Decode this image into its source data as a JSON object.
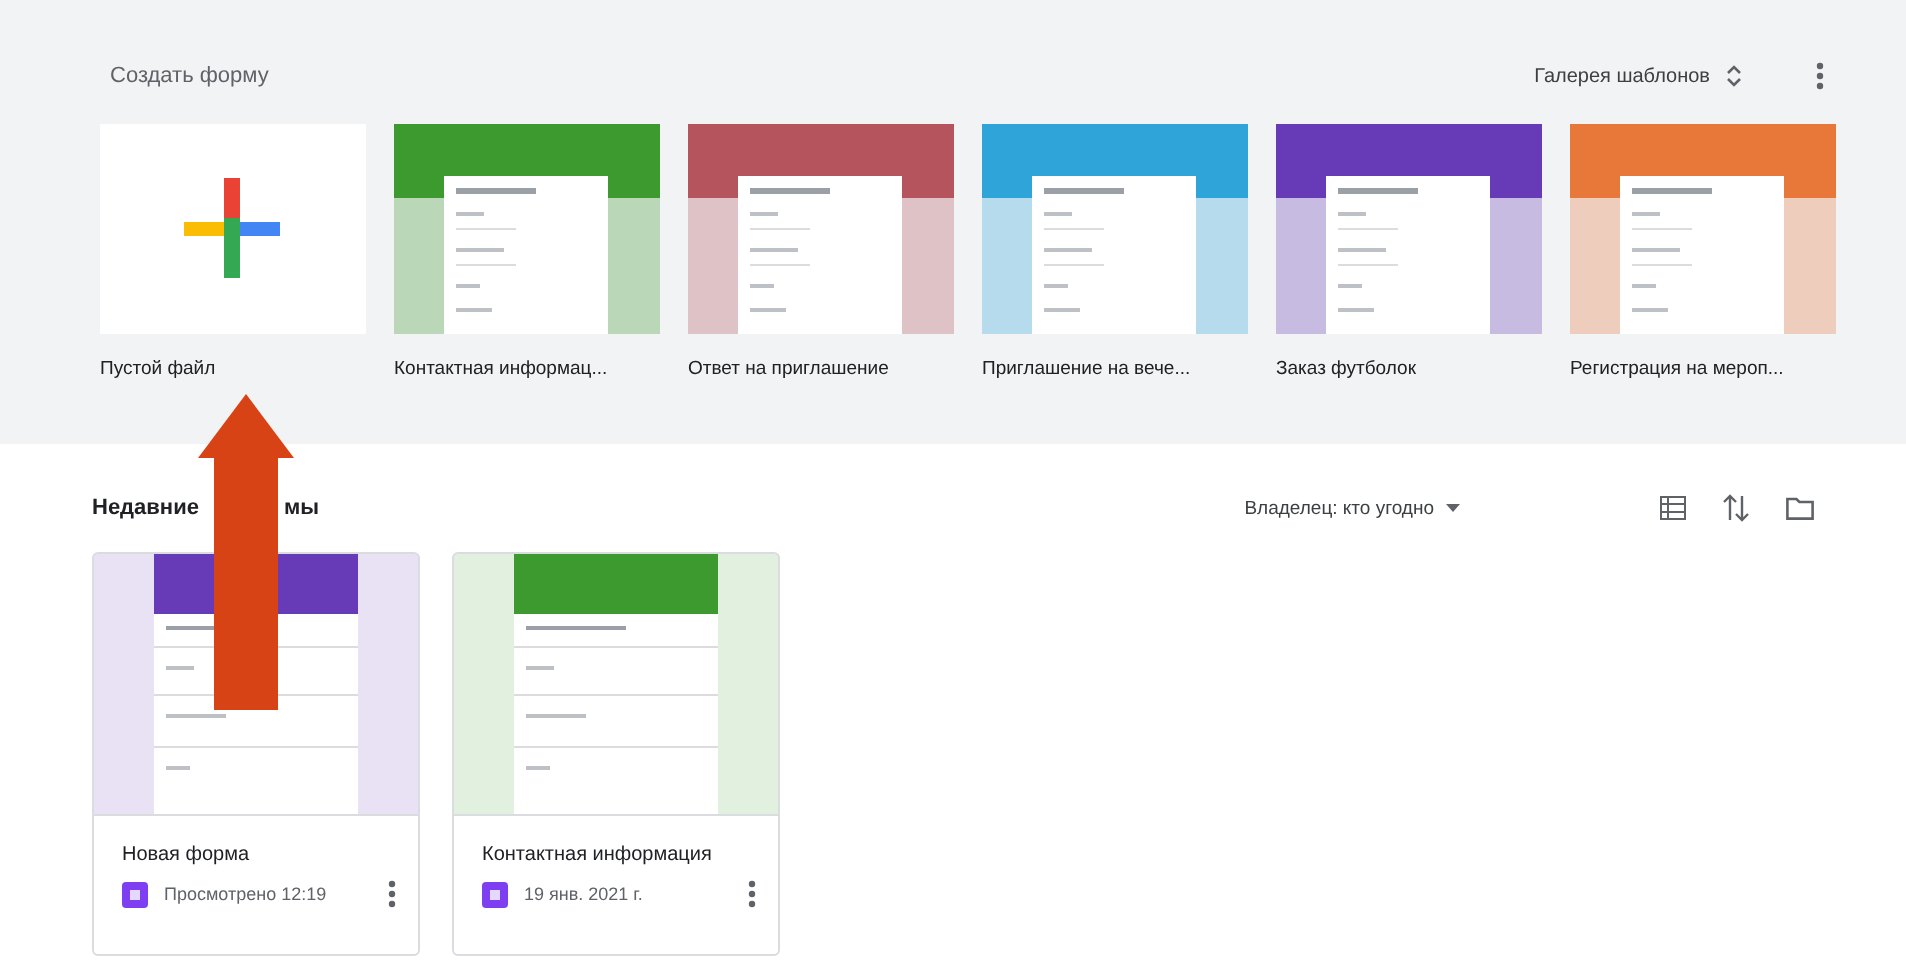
{
  "templates_header": {
    "title": "Создать форму",
    "gallery": "Галерея шаблонов"
  },
  "templates": [
    {
      "kind": "blank",
      "label": "Пустой файл"
    },
    {
      "kind": "form",
      "label": "Контактная информац...",
      "color": "#3d9a2e"
    },
    {
      "kind": "form",
      "label": "Ответ на приглашение",
      "color": "#b5545c"
    },
    {
      "kind": "form",
      "label": "Приглашение на вече...",
      "color": "#2ea4d9"
    },
    {
      "kind": "form",
      "label": "Заказ футболок",
      "color": "#673ab7"
    },
    {
      "kind": "form",
      "label": "Регистрация на мероп...",
      "color": "#e8773a"
    }
  ],
  "recent": {
    "title_parts": [
      "Недавние",
      "мы"
    ],
    "owner_filter": "Владелец: кто угодно"
  },
  "documents": [
    {
      "name": "Новая форма",
      "meta": "Просмотрено 12:19",
      "color": "#673ab7"
    },
    {
      "name": "Контактная информация",
      "meta": "19 янв. 2021 г.",
      "color": "#3d9a2e"
    }
  ]
}
